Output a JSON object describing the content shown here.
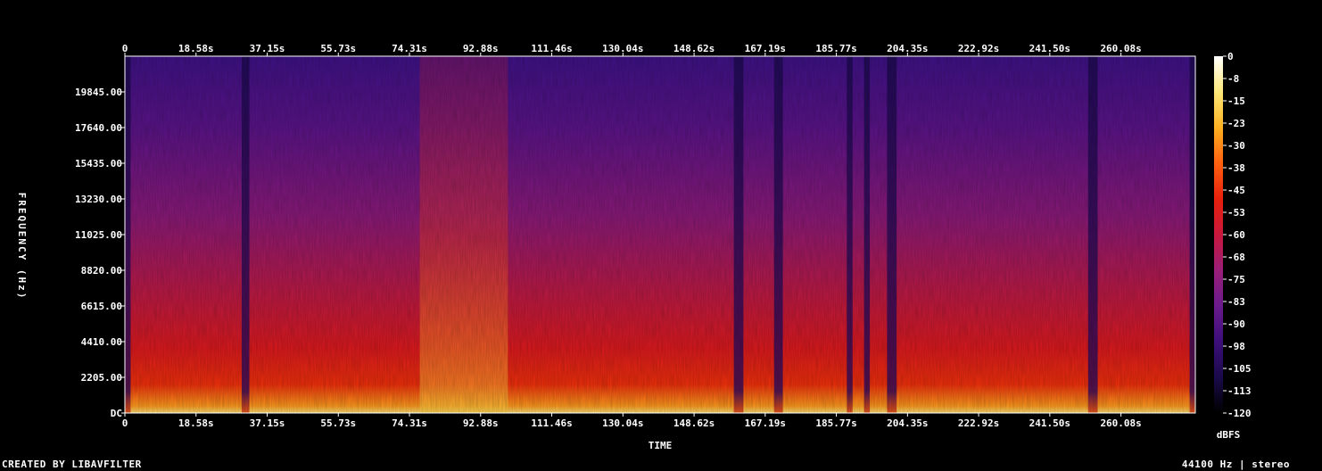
{
  "chart_data": {
    "type": "heatmap",
    "title": "",
    "xlabel": "TIME",
    "ylabel": "FREQUENCY (Hz)",
    "x_ticks": [
      "0",
      "18.58s",
      "37.15s",
      "55.73s",
      "74.31s",
      "92.88s",
      "111.46s",
      "130.04s",
      "148.62s",
      "167.19s",
      "185.77s",
      "204.35s",
      "222.92s",
      "241.50s",
      "260.08s"
    ],
    "x_tick_seconds": [
      0,
      18.58,
      37.15,
      55.73,
      74.31,
      92.88,
      111.46,
      130.04,
      148.62,
      167.19,
      185.77,
      204.35,
      222.92,
      241.5,
      260.08
    ],
    "x_max_seconds": 279.5,
    "y_ticks": [
      "DC",
      "2205.00",
      "4410.00",
      "6615.00",
      "8820.00",
      "11025.00",
      "13230.00",
      "15435.00",
      "17640.00",
      "19845.00"
    ],
    "y_tick_hz": [
      0,
      2205,
      4410,
      6615,
      8820,
      11025,
      13230,
      15435,
      17640,
      19845
    ],
    "y_max_hz": 22050,
    "colorbar": {
      "label": "dBFS",
      "ticks": [
        "0",
        "-8",
        "-15",
        "-23",
        "-30",
        "-38",
        "-45",
        "-53",
        "-60",
        "-68",
        "-75",
        "-83",
        "-90",
        "-98",
        "-105",
        "-113",
        "-120"
      ],
      "range": [
        -120,
        0
      ],
      "colormap": [
        "#000000",
        "#1a0a4a",
        "#3c0e7a",
        "#6a1a8c",
        "#9a1e78",
        "#c8183c",
        "#e8200c",
        "#ff6010",
        "#ffb020",
        "#ffe878",
        "#ffffff"
      ]
    },
    "quiet_segments_seconds": [
      [
        0,
        1.5
      ],
      [
        30.5,
        32.5
      ],
      [
        159.0,
        161.5
      ],
      [
        169.5,
        171.8
      ],
      [
        188.5,
        190.0
      ],
      [
        193.0,
        194.5
      ],
      [
        199.0,
        201.5
      ],
      [
        251.5,
        254.0
      ],
      [
        278.0,
        279.5
      ]
    ],
    "bright_segments_seconds": [
      [
        77.0,
        100.0
      ]
    ]
  },
  "footer": {
    "left": "CREATED BY LIBAVFILTER",
    "right": "44100 Hz | stereo"
  }
}
